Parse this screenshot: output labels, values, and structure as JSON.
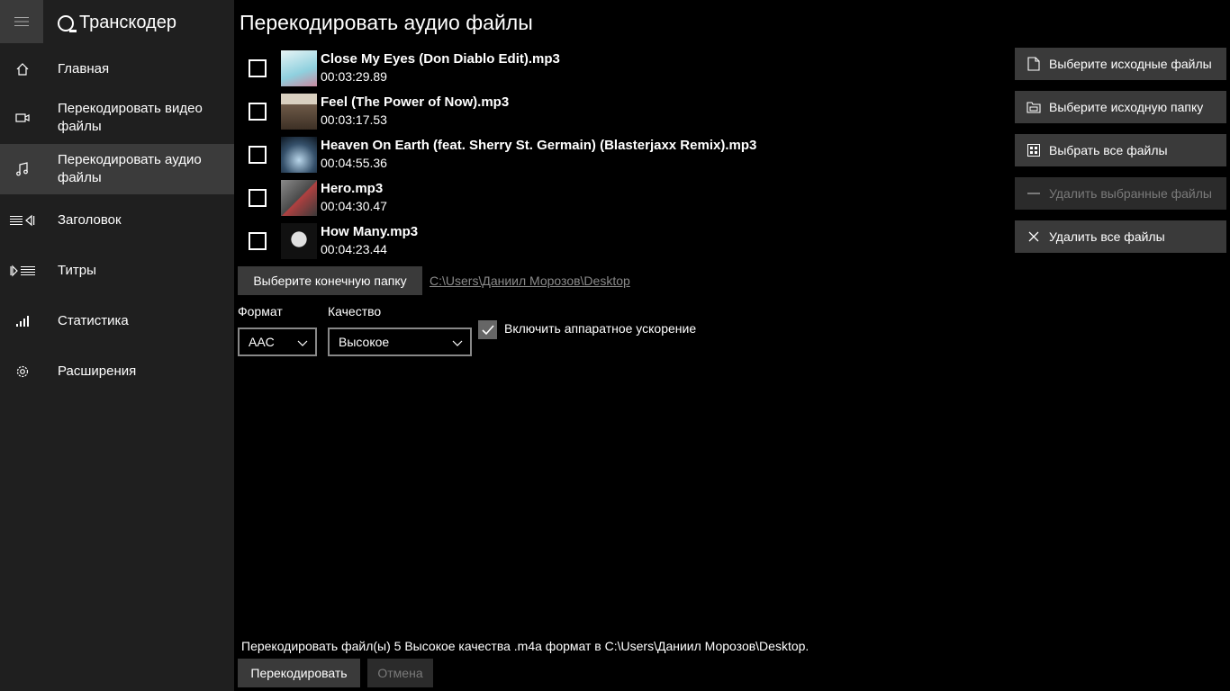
{
  "app": {
    "title": "Транскодер"
  },
  "sidebar": {
    "items": [
      {
        "label": "Главная",
        "icon": "home-icon"
      },
      {
        "label": "Перекодировать видео файлы",
        "icon": "video-icon"
      },
      {
        "label": "Перекодировать аудио файлы",
        "icon": "music-icon",
        "active": true
      },
      {
        "label": "Заголовок",
        "icon": "title-icon"
      },
      {
        "label": "Титры",
        "icon": "subtitles-icon"
      },
      {
        "label": "Статистика",
        "icon": "stats-icon"
      },
      {
        "label": "Расширения",
        "icon": "gear-icon"
      }
    ]
  },
  "main": {
    "title": "Перекодировать аудио файлы",
    "files": [
      {
        "name": "Close My Eyes (Don Diablo Edit).mp3",
        "duration": "00:03:29.89",
        "thumb_color": "#9fd3e0"
      },
      {
        "name": "Feel (The Power of Now).mp3",
        "duration": "00:03:17.53",
        "thumb_color": "#8a7a6a"
      },
      {
        "name": "Heaven On Earth (feat. Sherry St. Germain) (Blasterjaxx Remix).mp3",
        "duration": "00:04:55.36",
        "thumb_color": "#4a6a8a"
      },
      {
        "name": "Hero.mp3",
        "duration": "00:04:30.47",
        "thumb_color": "#6a6a6a"
      },
      {
        "name": "How Many.mp3",
        "duration": "00:04:23.44",
        "thumb_color": "#2a2a2a"
      }
    ],
    "actions": {
      "select_files": "Выберите исходные файлы",
      "select_folder": "Выберите исходную папку",
      "select_all": "Выбрать все файлы",
      "remove_selected": "Удалить выбранные файлы",
      "remove_all": "Удалить все файлы"
    },
    "dest_button": "Выберите конечную папку",
    "dest_path": "C:\\Users\\Даниил Морозов\\Desktop",
    "format_label": "Формат",
    "format_value": "AAC",
    "quality_label": "Качество",
    "quality_value": "Высокое",
    "hw_accel_label": "Включить аппаратное ускорение",
    "hw_accel_checked": true,
    "summary": "Перекодировать файл(ы) 5 Высокое качества .m4a формат в C:\\Users\\Даниил Морозов\\Desktop.",
    "transcode_button": "Перекодировать",
    "cancel_button": "Отмена"
  }
}
